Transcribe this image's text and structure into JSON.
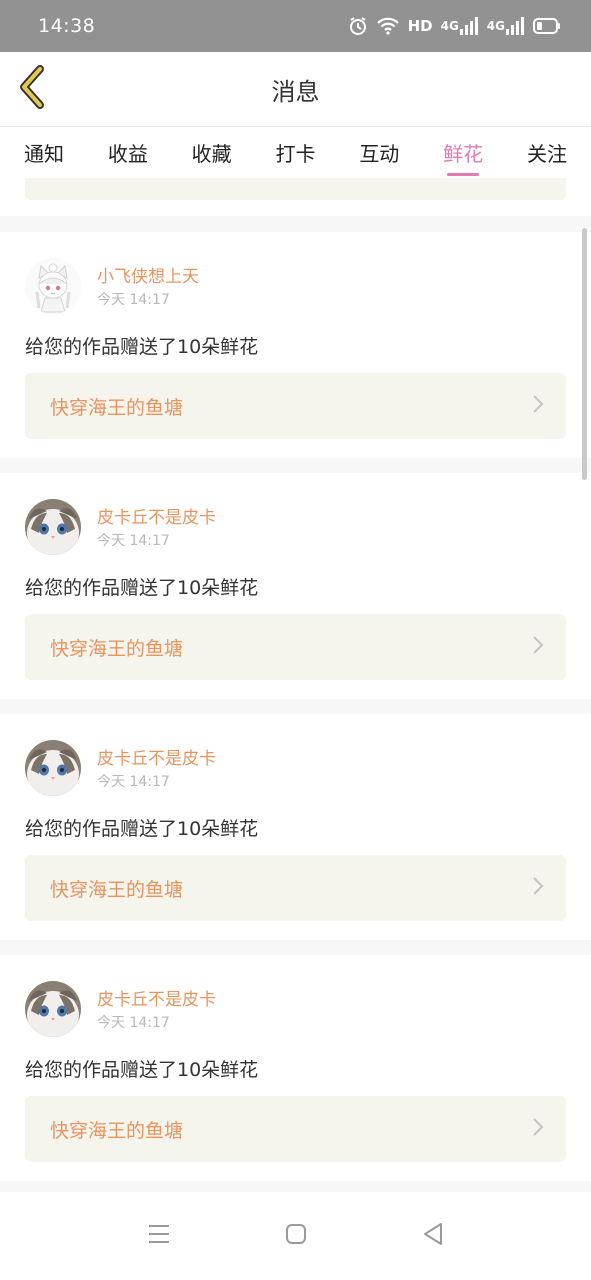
{
  "status_bar": {
    "time": "14:38",
    "hd_label": "HD",
    "net1_label": "4G",
    "net2_label": "4G",
    "icons": [
      "alarm-icon",
      "wifi-icon",
      "hd-icon",
      "signal-icon",
      "signal-icon",
      "battery-icon"
    ]
  },
  "header": {
    "title": "消息",
    "back_icon": "chevron-left-icon",
    "accent_color": "#e6c84a"
  },
  "tabs": [
    {
      "label": "通知",
      "active": false
    },
    {
      "label": "收益",
      "active": false
    },
    {
      "label": "收藏",
      "active": false
    },
    {
      "label": "打卡",
      "active": false
    },
    {
      "label": "互动",
      "active": false
    },
    {
      "label": "鲜花",
      "active": true
    },
    {
      "label": "关注",
      "active": false
    }
  ],
  "colors": {
    "active_tab": "#e27bb3",
    "username": "#e8945e",
    "link_bg": "#f5f4ed"
  },
  "messages": [
    {
      "user": "小飞侠想上天",
      "time": "今天 14:17",
      "text": "给您的作品赠送了10朵鲜花",
      "work_title": "快穿海王的鱼塘",
      "avatar": "anime-girl-avatar"
    },
    {
      "user": "皮卡丘不是皮卡",
      "time": "今天 14:17",
      "text": "给您的作品赠送了10朵鲜花",
      "work_title": "快穿海王的鱼塘",
      "avatar": "cat-avatar"
    },
    {
      "user": "皮卡丘不是皮卡",
      "time": "今天 14:17",
      "text": "给您的作品赠送了10朵鲜花",
      "work_title": "快穿海王的鱼塘",
      "avatar": "cat-avatar"
    },
    {
      "user": "皮卡丘不是皮卡",
      "time": "今天 14:17",
      "text": "给您的作品赠送了10朵鲜花",
      "work_title": "快穿海王的鱼塘",
      "avatar": "cat-avatar"
    }
  ],
  "nav_bar": {
    "icons": [
      "menu-icon",
      "home-square-icon",
      "back-triangle-icon"
    ]
  }
}
